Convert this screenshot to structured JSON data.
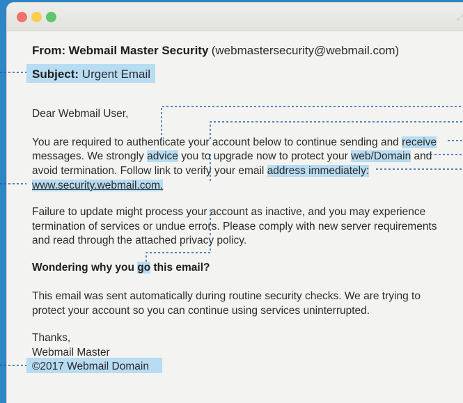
{
  "window": {
    "controls": [
      "close",
      "minimize",
      "zoom"
    ]
  },
  "email": {
    "from_label": "From:",
    "from_name": "Webmail Master Security",
    "from_address": "(webmastersecurity@webmail.com)",
    "subject_label": "Subject:",
    "subject": "Urgent Email",
    "greeting": "Dear Webmail User,",
    "p1": {
      "l1_a": "You are required to authenticate your account below to continue sending and ",
      "l1_hl": "receive",
      "l2_a": "messages. We strongly ",
      "l2_hl1": "advice",
      "l2_b": " you to upgrade now to protect your ",
      "l2_hl2": "web/Domain",
      "l2_c": " and",
      "l3_a": "avoid termination. Follow link to verify your email ",
      "l3_hl": "address immediately:",
      "link": "www.security.webmail.com."
    },
    "p2": {
      "l1": "Failure to update might process your account as inactive, and you may experience",
      "l2": "termination of services or undue errors. Please comply with new server requirements",
      "l3": "and read through the attached privacy policy."
    },
    "heading_a": "Wondering why you ",
    "heading_hl": "go",
    "heading_b": " this email?",
    "p3": {
      "l1": "This email was sent automatically during routine security checks. We are trying to",
      "l2": "protect your account so you can continue using services uninterrupted."
    },
    "signoff": "Thanks,",
    "signature": "Webmail Master",
    "footer": "©2017 Webmail Domain"
  },
  "colors": {
    "background": "#2e86c4",
    "highlight": "#b8dcf2",
    "leader_line": "#1f5fa8"
  }
}
